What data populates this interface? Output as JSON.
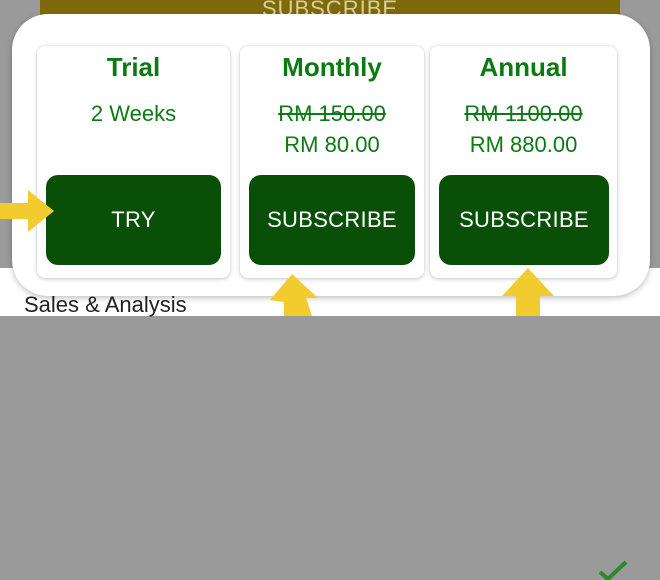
{
  "background": {
    "header_text": "SUBSCRIBE",
    "lower_text": "Sales & Analysis"
  },
  "plans": {
    "trial": {
      "title": "Trial",
      "duration": "2 Weeks",
      "button": "TRY"
    },
    "monthly": {
      "title": "Monthly",
      "old_price": "RM 150.00",
      "price": "RM 80.00",
      "button": "SUBSCRIBE"
    },
    "annual": {
      "title": "Annual",
      "old_price": "RM 1100.00",
      "price": "RM 880.00",
      "button": "SUBSCRIBE"
    }
  },
  "colors": {
    "title_green": "#0c7a12",
    "button_green": "#0a4f08",
    "arrow_yellow": "#f2cc2e"
  },
  "icons": [
    "arrow-right-icon",
    "arrow-up-icon",
    "check-icon"
  ]
}
